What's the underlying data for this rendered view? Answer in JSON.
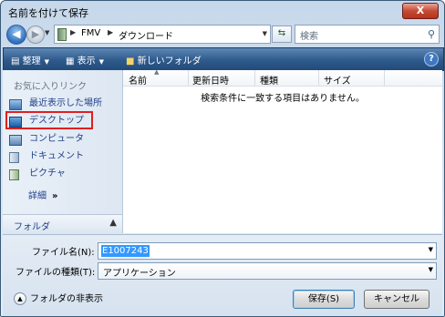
{
  "window": {
    "title": "名前を付けて保存",
    "close_label": "X"
  },
  "nav": {
    "back_glyph": "◀",
    "forward_glyph": "▶",
    "breadcrumb": [
      "FMV",
      "ダウンロード"
    ],
    "search_placeholder": "検索"
  },
  "toolbar": {
    "organize": "整理",
    "views": "表示",
    "new_folder": "新しいフォルダ",
    "help": "?"
  },
  "sidebar": {
    "title": "お気に入りリンク",
    "items": [
      {
        "label": "最近表示した場所",
        "icon": "recent-places-icon"
      },
      {
        "label": "デスクトップ",
        "icon": "desktop-icon"
      },
      {
        "label": "コンピュータ",
        "icon": "computer-icon"
      },
      {
        "label": "ドキュメント",
        "icon": "documents-icon"
      },
      {
        "label": "ピクチャ",
        "icon": "pictures-icon"
      }
    ],
    "more_label": "詳細",
    "more_glyph": "»",
    "folders_label": "フォルダ",
    "highlight_color": "#e01f1f"
  },
  "filelist": {
    "columns": [
      "名前",
      "更新日時",
      "種類",
      "サイズ"
    ],
    "empty_message": "検索条件に一致する項目はありません。"
  },
  "form": {
    "filename_label": "ファイル名(N):",
    "filename_value": "E1007243",
    "filetype_label": "ファイルの種類(T):",
    "filetype_value": "アプリケーション",
    "hide_folders": "フォルダの非表示",
    "save": "保存(S)",
    "cancel": "キャンセル"
  }
}
